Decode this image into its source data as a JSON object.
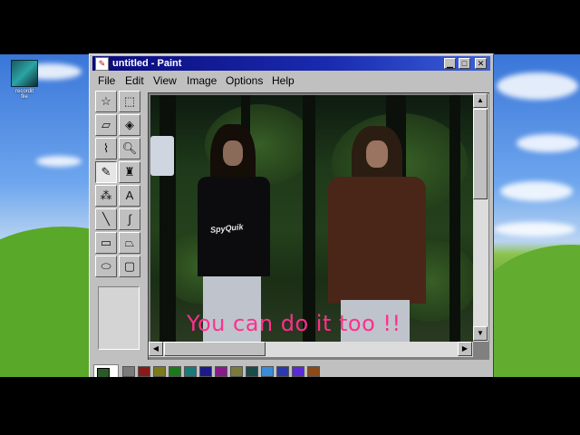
{
  "desktop": {
    "icon_label": "recordit\nfile"
  },
  "window": {
    "title": "untitled - Paint",
    "title_icon": "paint-icon",
    "buttons": {
      "minimize": "▁",
      "maximize": "□",
      "close": "✕"
    }
  },
  "menu": [
    "File",
    "Edit",
    "View",
    "Image",
    "Options",
    "Help"
  ],
  "tools": [
    "free-select",
    "rect-select",
    "eraser",
    "fill",
    "color-picker",
    "magnifier",
    "pencil",
    "brush",
    "airbrush",
    "text",
    "line",
    "curve",
    "rectangle",
    "polygon",
    "ellipse",
    "rounded-rectangle"
  ],
  "active_tool": "pencil",
  "canvas": {
    "caption": "You can do it too !!",
    "shirt_text": "SpyQuik"
  },
  "palette_colors": [
    "#7a7a7a",
    "#8a1a1a",
    "#7a7a1a",
    "#1a7a1a",
    "#1a7a7a",
    "#1a1a8a",
    "#8a1a8a",
    "#7a7a3a",
    "#1a4a4a",
    "#3a8ad8",
    "#2a3aaa",
    "#5a2ad8",
    "#8a4a1a"
  ],
  "foreground_color": "#2a5a2a"
}
